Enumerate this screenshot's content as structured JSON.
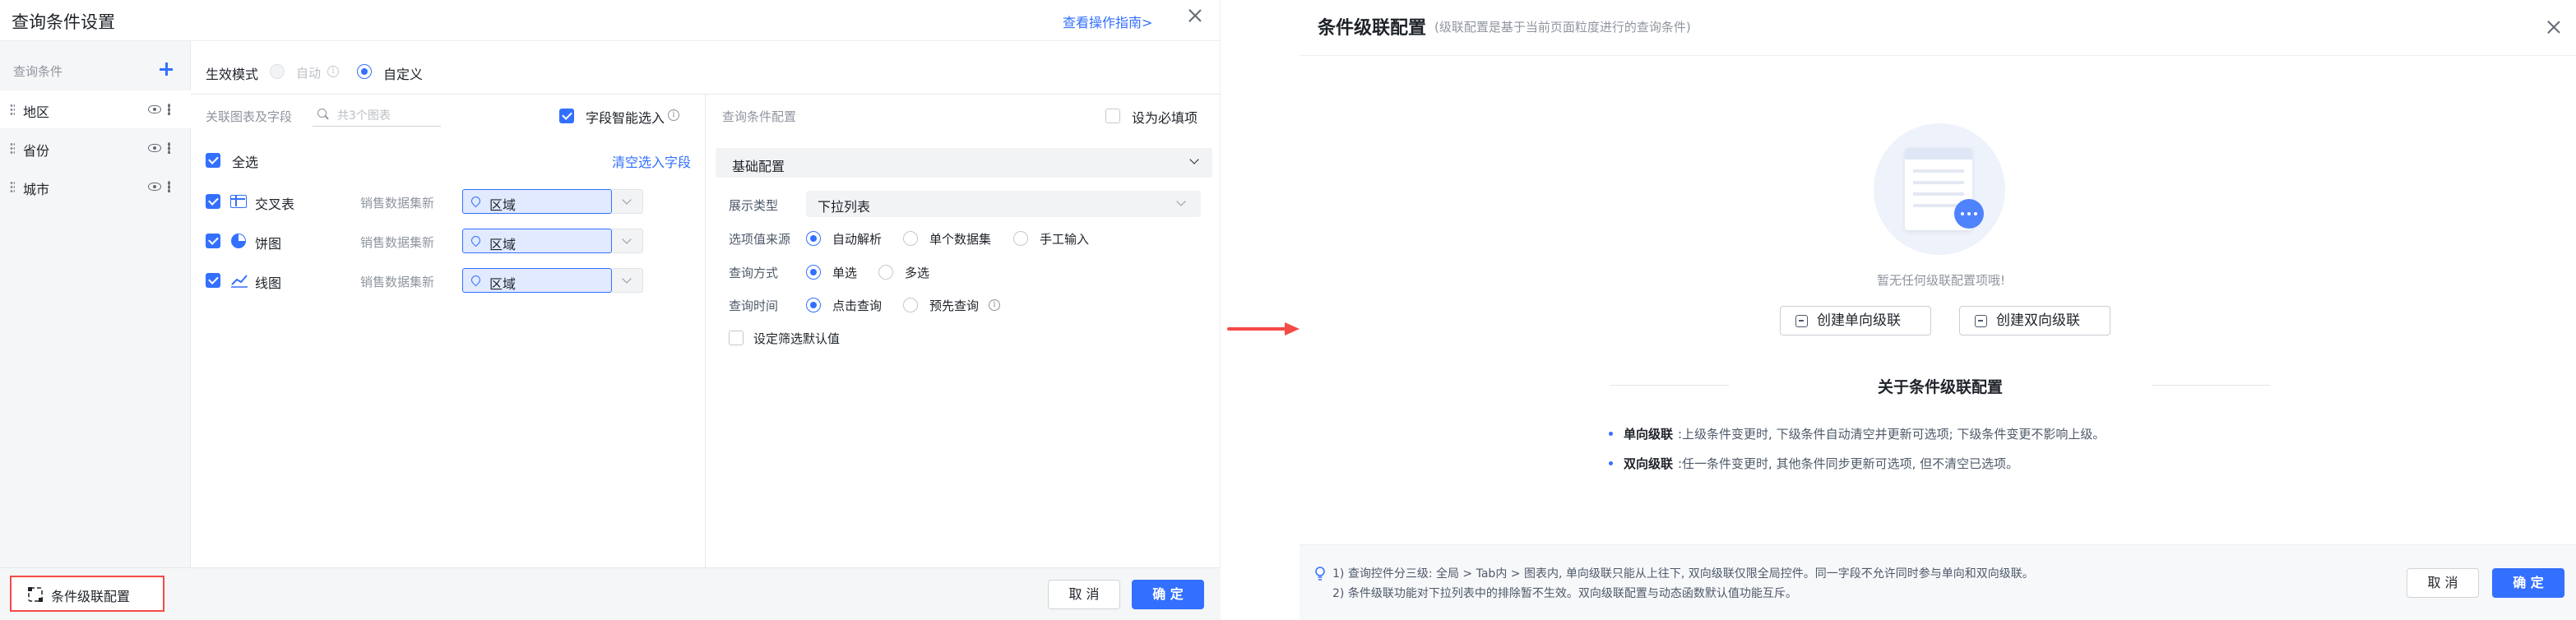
{
  "left_dialog": {
    "title": "查询条件设置",
    "guide_link": "查看操作指南>",
    "sidebar": {
      "header": "查询条件",
      "items": [
        {
          "label": "地区"
        },
        {
          "label": "省份"
        },
        {
          "label": "城市"
        }
      ]
    },
    "mode": {
      "label": "生效模式",
      "options": [
        {
          "label": "自动",
          "selected": false,
          "disabled": true
        },
        {
          "label": "自定义",
          "selected": true
        }
      ]
    },
    "assoc": {
      "label": "关联图表及字段",
      "search_placeholder": "共3个图表",
      "smart_select_label": "字段智能选入",
      "select_all_label": "全选",
      "clear_link": "清空选入字段",
      "rows": [
        {
          "chart": "交叉表",
          "dataset": "销售数据集新",
          "field": "区域",
          "icon": "cross-table-icon"
        },
        {
          "chart": "饼图",
          "dataset": "销售数据集新",
          "field": "区域",
          "icon": "pie-chart-icon"
        },
        {
          "chart": "线图",
          "dataset": "销售数据集新",
          "field": "区域",
          "icon": "line-chart-icon"
        }
      ]
    },
    "config": {
      "title": "查询条件配置",
      "required_label": "设为必填项",
      "section_title": "基础配置",
      "display_type_label": "展示类型",
      "display_type_value": "下拉列表",
      "source_label": "选项值来源",
      "source_options": [
        {
          "label": "自动解析",
          "selected": true
        },
        {
          "label": "单个数据集",
          "selected": false
        },
        {
          "label": "手工输入",
          "selected": false
        }
      ],
      "query_mode_label": "查询方式",
      "query_mode_options": [
        {
          "label": "单选",
          "selected": true
        },
        {
          "label": "多选",
          "selected": false
        }
      ],
      "query_time_label": "查询时间",
      "query_time_options": [
        {
          "label": "点击查询",
          "selected": true
        },
        {
          "label": "预先查询",
          "selected": false
        }
      ],
      "default_filter_label": "设定筛选默认值"
    },
    "footer": {
      "cascade_button": "条件级联配置",
      "cancel": "取 消",
      "ok": "确 定"
    }
  },
  "right_dialog": {
    "title": "条件级联配置",
    "subtitle": "(级联配置是基于当前页面粒度进行的查询条件)",
    "empty_text": "暂无任何级联配置项哦!",
    "create_single": "创建单向级联",
    "create_double": "创建双向级联",
    "about_title": "关于条件级联配置",
    "about_items": [
      {
        "term": "单向级联",
        "desc": ":上级条件变更时, 下级条件自动清空并更新可选项; 下级条件变更不影响上级。"
      },
      {
        "term": "双向级联",
        "desc": ":任一条件变更时, 其他条件同步更新可选项, 但不清空已选项。"
      }
    ],
    "tips": [
      "1) 查询控件分三级: 全局 > Tab内 > 图表内, 单向级联只能从上往下, 双向级联仅限全局控件。同一字段不允许同时参与单向和双向级联。",
      "2) 条件级联功能对下拉列表中的排除暂不生效。双向级联配置与动态函数默认值功能互斥。"
    ],
    "cancel": "取 消",
    "ok": "确 定"
  },
  "colors": {
    "primary": "#3370ff",
    "highlight_border": "#f54a45",
    "arrow": "#f54a45"
  }
}
